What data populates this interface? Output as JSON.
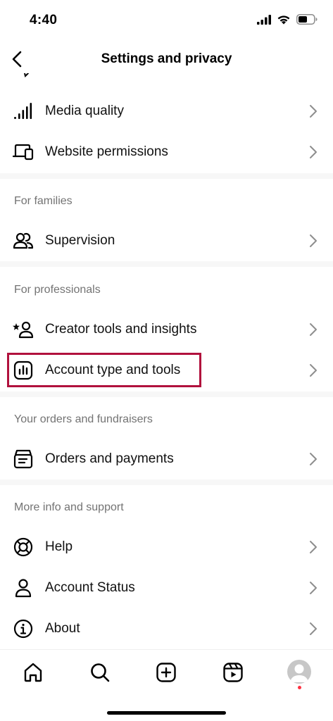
{
  "status_bar": {
    "time": "4:40"
  },
  "header": {
    "title": "Settings and privacy"
  },
  "sections": {
    "top": {
      "items": [
        {
          "label": "Media quality",
          "icon": "signal-bars-icon"
        },
        {
          "label": "Website permissions",
          "icon": "devices-icon"
        }
      ]
    },
    "families": {
      "title": "For families",
      "items": [
        {
          "label": "Supervision",
          "icon": "people-icon"
        }
      ]
    },
    "professionals": {
      "title": "For professionals",
      "items": [
        {
          "label": "Creator tools and insights",
          "icon": "star-person-icon"
        },
        {
          "label": "Account type and tools",
          "icon": "bar-chart-icon"
        }
      ]
    },
    "orders": {
      "title": "Your orders and fundraisers",
      "items": [
        {
          "label": "Orders and payments",
          "icon": "receipt-box-icon"
        }
      ]
    },
    "support": {
      "title": "More info and support",
      "items": [
        {
          "label": "Help",
          "icon": "lifebuoy-icon"
        },
        {
          "label": "Account Status",
          "icon": "person-icon"
        },
        {
          "label": "About",
          "icon": "info-icon"
        }
      ]
    }
  },
  "tab_bar": {
    "tabs": [
      "home-icon",
      "search-icon",
      "create-icon",
      "reels-icon",
      "profile-avatar"
    ]
  },
  "colors": {
    "highlight": "#b1113d",
    "section_header": "#737373",
    "notification": "#ff3040"
  }
}
